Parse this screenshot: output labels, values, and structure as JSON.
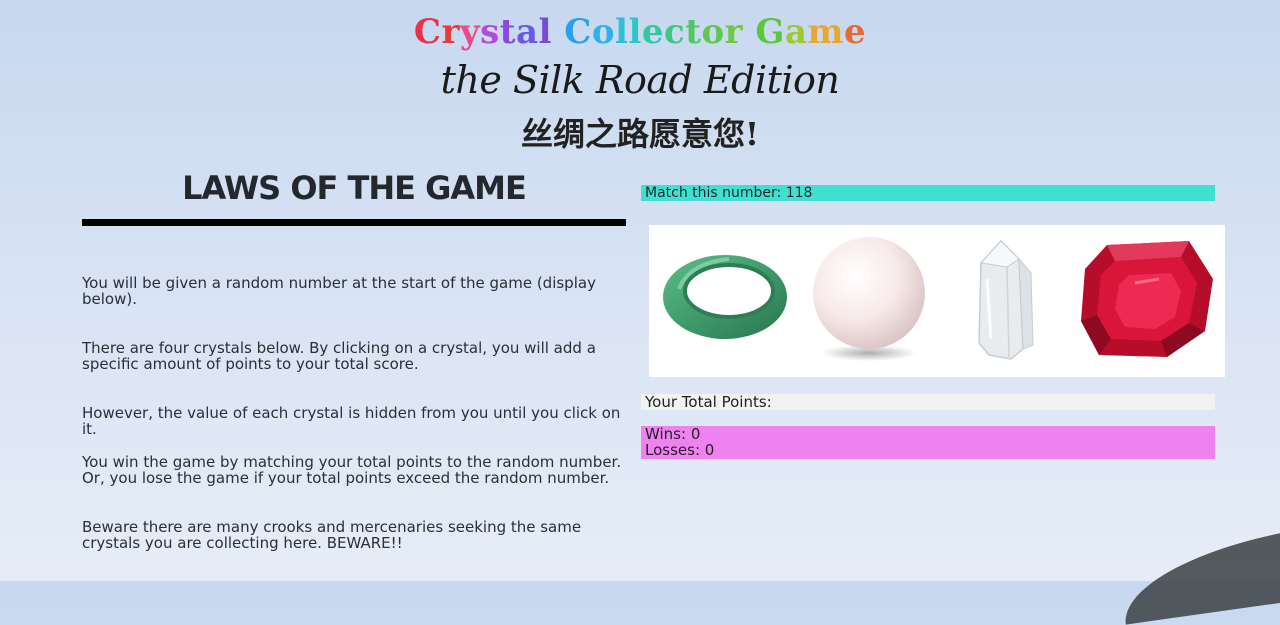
{
  "header": {
    "title_words": [
      {
        "text": "Crystal",
        "colors": [
          "#e8314a",
          "#e83a3a",
          "#e84a8a",
          "#b34ad8",
          "#8a4ae0",
          "#6a5ae8",
          "#7a4ad0"
        ]
      },
      {
        "text": "Collector",
        "colors": [
          "#2aa0e8",
          "#30b0e8",
          "#2ac0d8",
          "#2ac8c0",
          "#30c8a0",
          "#40c880",
          "#50c860",
          "#60c850",
          "#70c840"
        ]
      },
      {
        "text": "Game",
        "colors": [
          "#5ac83a",
          "#a0c830",
          "#e8a830",
          "#e86a30"
        ]
      }
    ],
    "subtitle": "the Silk Road Edition",
    "chinese_line": "丝绸之路愿意您!"
  },
  "rules": {
    "heading": "LAWS OF THE GAME",
    "items": [
      "You will be given a random number at the start of the game (display below).",
      "There are four crystals below. By clicking on a crystal, you will add a specific amount of points to your total score.",
      "However, the value of each crystal is hidden from you until you click on it.",
      "You win the game by matching your total points to the random number. Or, you lose the game if your total points exceed the random number.",
      "Beware there are many crooks and mercenaries seeking the same crystals you are collecting here. BEWARE!!"
    ]
  },
  "game": {
    "match_label": "Match this number: 118",
    "crystals": [
      {
        "icon": "jade-ring-icon",
        "color": "#3f9a6b"
      },
      {
        "icon": "pearl-icon",
        "color": "#f5e6e6"
      },
      {
        "icon": "quartz-crystal-icon",
        "color": "#e6e9ec"
      },
      {
        "icon": "ruby-icon",
        "color": "#c8102e"
      }
    ],
    "total_label": "Your Total Points:",
    "wins_label": "Wins: 0",
    "losses_label": "Losses: 0"
  },
  "colors": {
    "match_bar": "#40e0d0",
    "score_box": "#ee82ee",
    "rules_bar": "#000000"
  }
}
